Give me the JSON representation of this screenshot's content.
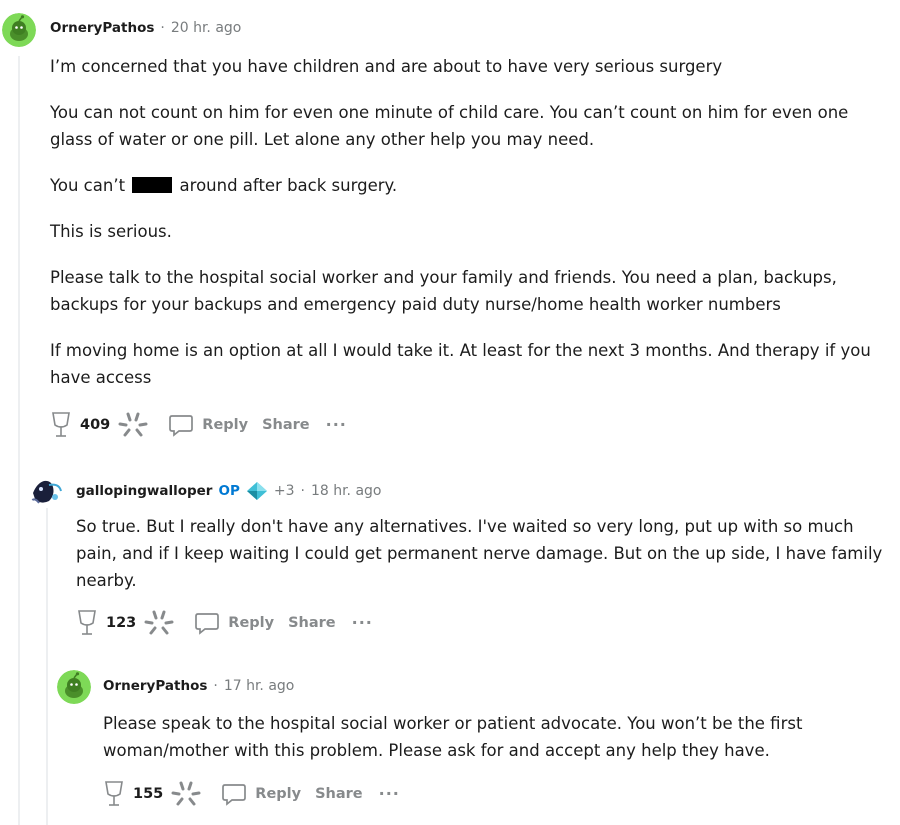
{
  "comments": [
    {
      "author": "OrneryPathos",
      "time": "20 hr. ago",
      "paragraphs": [
        "I’m concerned that you have children and are about to have very serious surgery",
        "You can not count on him for even one minute of child care. You can’t count on him for even one glass of water or one pill. Let alone any other help you may need.",
        "This is serious.",
        "Please talk to the hospital social worker and your family and friends. You need a plan, backups, backups for your backups and emergency paid duty nurse/home health worker numbers",
        "If moving home is an option at all I would take it. At least for the next 3 months. And therapy if you have access"
      ],
      "redacted_line": {
        "before": "You can’t",
        "after": "around after back surgery."
      },
      "score": "409",
      "reply_label": "Reply",
      "share_label": "Share",
      "more_label": "···"
    },
    {
      "author": "gallopingwalloper",
      "op_tag": "OP",
      "flair_count": "+3",
      "time": "18 hr. ago",
      "paragraphs": [
        "So true. But I really don't have any alternatives. I've waited so very long, put up with so much pain, and if I keep waiting I could get permanent nerve damage. But on the up side, I have family nearby."
      ],
      "score": "123",
      "reply_label": "Reply",
      "share_label": "Share",
      "more_label": "···"
    },
    {
      "author": "OrneryPathos",
      "time": "17 hr. ago",
      "paragraphs": [
        "Please speak to the hospital social worker or patient advocate. You won’t be the first woman/mother with this problem. Please ask for and accept any help they have."
      ],
      "score": "155",
      "reply_label": "Reply",
      "share_label": "Share",
      "more_label": "···"
    }
  ],
  "separator": "·",
  "colors": {
    "avatar_green": "#7ed957",
    "op_blue": "#0079d3",
    "meta_gray": "#787c7e",
    "thread_line": "#edeff1"
  }
}
